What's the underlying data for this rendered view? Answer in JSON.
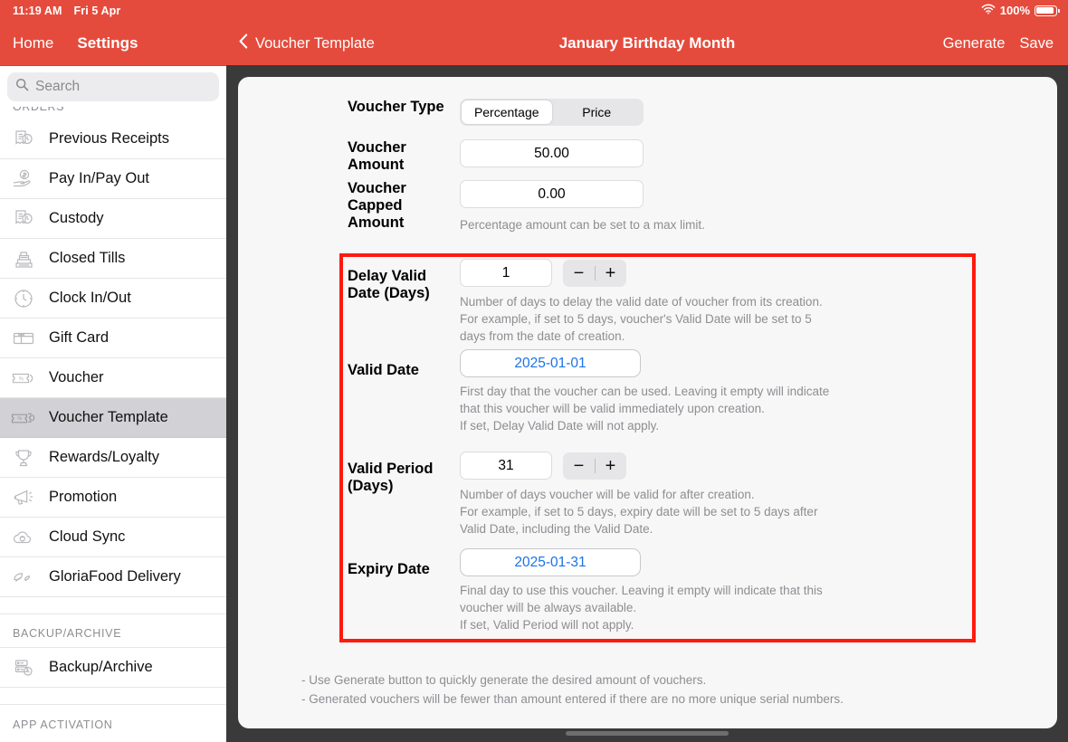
{
  "status_bar": {
    "time": "11:19 AM",
    "date": "Fri 5 Apr",
    "battery_percent": "100%",
    "wifi_icon": "wifi-icon",
    "battery_icon": "battery-full-icon"
  },
  "sidebar": {
    "home_label": "Home",
    "settings_label": "Settings",
    "search": {
      "placeholder": "Search",
      "icon": "search-icon"
    },
    "clipped_header": "ORDERS",
    "items": [
      {
        "label": "Previous Receipts",
        "icon": "receipt-clock-icon",
        "selected": false
      },
      {
        "label": "Pay In/Pay Out",
        "icon": "hand-cash-icon",
        "selected": false
      },
      {
        "label": "Custody",
        "icon": "receipt-clock-icon",
        "selected": false
      },
      {
        "label": "Closed Tills",
        "icon": "cash-register-icon",
        "selected": false
      },
      {
        "label": "Clock In/Out",
        "icon": "clock-icon",
        "selected": false
      },
      {
        "label": "Gift Card",
        "icon": "gift-card-icon",
        "selected": false
      },
      {
        "label": "Voucher",
        "icon": "voucher-ticket-icon",
        "selected": false
      },
      {
        "label": "Voucher Template",
        "icon": "voucher-template-icon",
        "selected": true
      },
      {
        "label": "Rewards/Loyalty",
        "icon": "trophy-icon",
        "selected": false
      },
      {
        "label": "Promotion",
        "icon": "megaphone-icon",
        "selected": false
      },
      {
        "label": "Cloud Sync",
        "icon": "cloud-sync-icon",
        "selected": false
      },
      {
        "label": "GloriaFood Delivery",
        "icon": "leaf-icon",
        "selected": false
      }
    ],
    "section_backup": {
      "header": "BACKUP/ARCHIVE",
      "item_label": "Backup/Archive",
      "item_icon": "server-clock-icon"
    },
    "section_activation": {
      "header": "APP ACTIVATION"
    }
  },
  "topbar": {
    "back_label": "Voucher Template",
    "back_icon": "chevron-left-icon",
    "title": "January Birthday Month",
    "generate_label": "Generate",
    "save_label": "Save",
    "accent_color": "#e54b3c"
  },
  "form": {
    "voucher_type": {
      "label": "Voucher Type",
      "options": [
        "Percentage",
        "Price"
      ],
      "selected": "Percentage"
    },
    "voucher_amount": {
      "label": "Voucher Amount",
      "value": "50.00"
    },
    "voucher_capped_amount": {
      "label": "Voucher Capped Amount",
      "value": "0.00",
      "hint": "Percentage amount can be set to a max limit."
    },
    "delay_valid_date": {
      "label": "Delay Valid Date (Days)",
      "value": "1",
      "minus_label": "−",
      "plus_label": "+",
      "hint_line1": "Number of days to delay the valid date of voucher from its creation.",
      "hint_line2": "For example, if set to 5 days, voucher's Valid Date will be set to 5",
      "hint_line3": "days from the date of creation."
    },
    "valid_date": {
      "label": "Valid Date",
      "value": "2025-01-01",
      "value_color": "#1a73e8",
      "hint_line1": "First day that the voucher can be used. Leaving it empty will indicate",
      "hint_line2": "that this voucher will be valid immediately upon creation.",
      "hint_line3": "If set, Delay Valid Date will not apply."
    },
    "valid_period": {
      "label": "Valid Period (Days)",
      "value": "31",
      "minus_label": "−",
      "plus_label": "+",
      "hint_line1": "Number of days voucher will be valid for after creation.",
      "hint_line2": "For example, if set to 5 days, expiry date will be set to 5 days after",
      "hint_line3": "Valid Date, including the Valid Date."
    },
    "expiry_date": {
      "label": "Expiry Date",
      "value": "2025-01-31",
      "value_color": "#1a73e8",
      "hint_line1": "Final day to use this voucher. Leaving it empty will indicate that this",
      "hint_line2": "voucher will be always available.",
      "hint_line3": "If set, Valid Period will not apply."
    },
    "highlight_color": "#ff1a0f",
    "footnotes": [
      "- Use Generate button to quickly generate the desired amount of vouchers.",
      "- Generated vouchers will be fewer than amount entered if there are no more unique serial numbers."
    ]
  }
}
